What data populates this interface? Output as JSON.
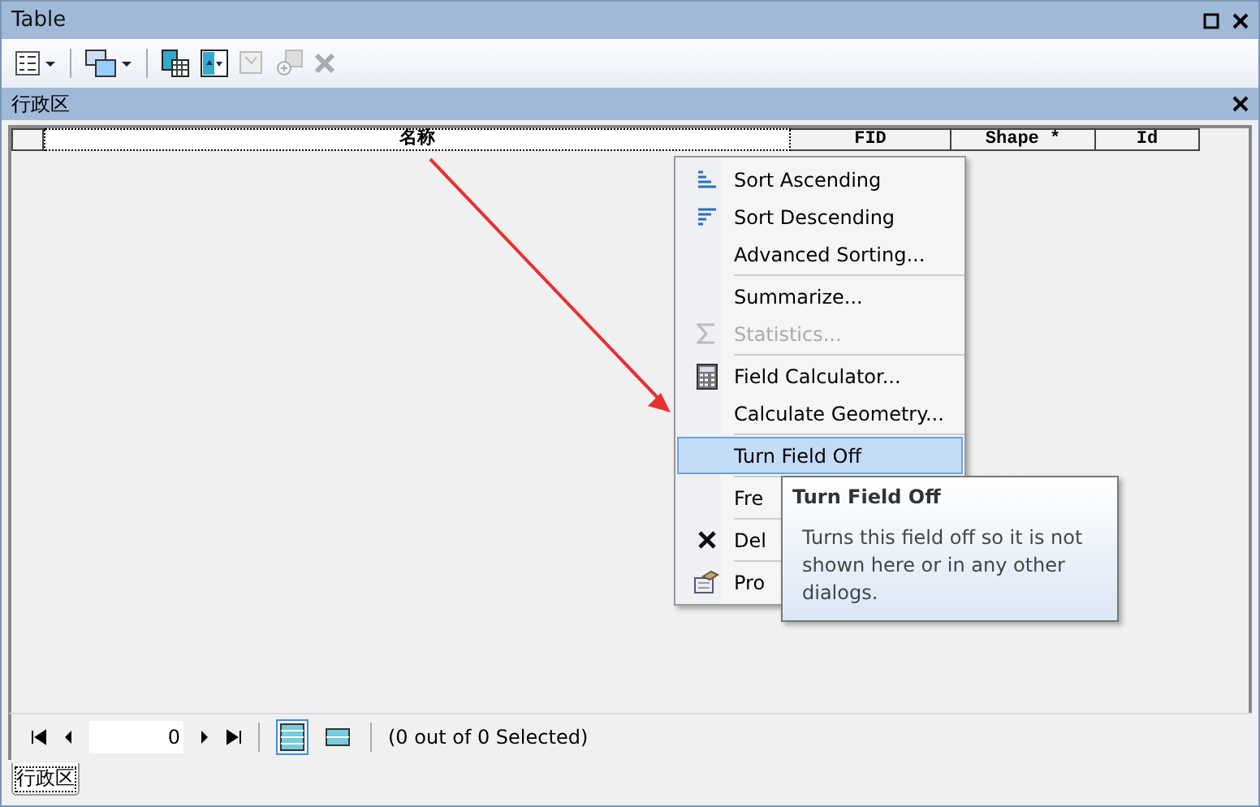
{
  "window": {
    "title": "Table"
  },
  "table": {
    "title": "行政区",
    "columns": [
      {
        "label": "名称",
        "focused": true
      },
      {
        "label": "FID",
        "focused": false
      },
      {
        "label": "Shape *",
        "focused": false
      },
      {
        "label": "Id",
        "focused": false
      }
    ]
  },
  "context_menu": {
    "items": [
      {
        "kind": "ascending",
        "label": "Sort Ascending",
        "disabled": false,
        "selected": false
      },
      {
        "kind": "descending",
        "label": "Sort Descending",
        "disabled": false,
        "selected": false
      },
      {
        "kind": "plain",
        "label": "Advanced Sorting...",
        "disabled": false,
        "selected": false
      },
      {
        "kind": "separator"
      },
      {
        "kind": "plain",
        "label": "Summarize...",
        "disabled": false,
        "selected": false
      },
      {
        "kind": "sum",
        "label": "Statistics...",
        "disabled": true,
        "selected": false
      },
      {
        "kind": "separator"
      },
      {
        "kind": "calculator",
        "label": "Field Calculator...",
        "disabled": false,
        "selected": false
      },
      {
        "kind": "plain",
        "label": "Calculate Geometry...",
        "disabled": false,
        "selected": false
      },
      {
        "kind": "separator"
      },
      {
        "kind": "plain",
        "label": "Turn Field Off",
        "disabled": false,
        "selected": true
      },
      {
        "kind": "separator"
      },
      {
        "kind": "plain",
        "label": "Fre",
        "disabled": false,
        "selected": false
      },
      {
        "kind": "separator"
      },
      {
        "kind": "delete",
        "label": "Del",
        "disabled": false,
        "selected": false
      },
      {
        "kind": "separator"
      },
      {
        "kind": "properties",
        "label": "Pro",
        "disabled": false,
        "selected": false
      }
    ]
  },
  "tooltip": {
    "title": "Turn Field Off",
    "text": "Turns this field off so it is not shown here or in any other dialogs."
  },
  "navigator": {
    "record": "0",
    "views": [
      {
        "selected": true
      },
      {
        "selected": false
      }
    ],
    "status": "(0 out of 0 Selected)"
  },
  "bottom_tabs": [
    {
      "label": "行政区",
      "selected": true
    }
  ]
}
